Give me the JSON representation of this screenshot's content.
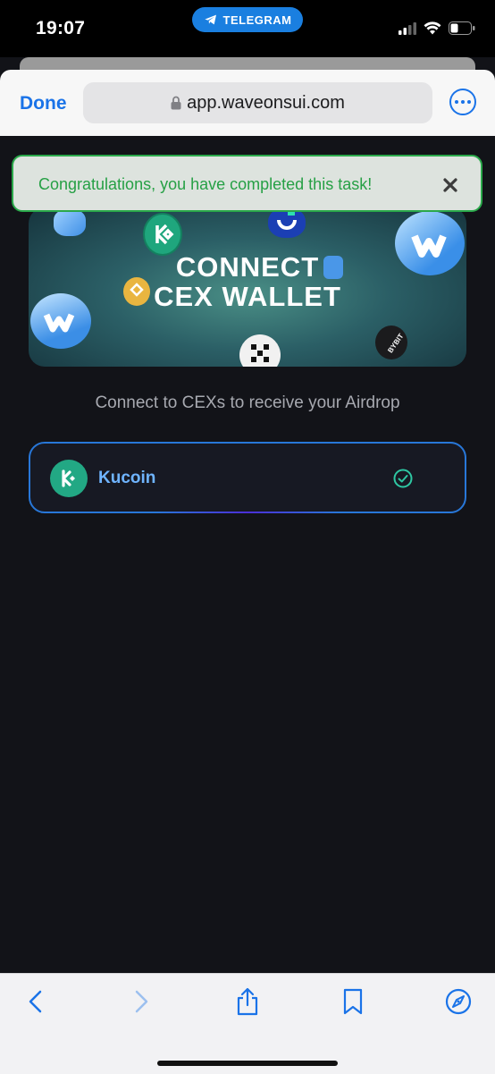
{
  "status_bar": {
    "time": "19:07",
    "back_app_label": "TELEGRAM"
  },
  "browser": {
    "done_label": "Done",
    "url": "app.waveonsui.com"
  },
  "toast": {
    "message": "Congratulations, you have completed this task!"
  },
  "banner": {
    "title_line1": "CONNECT",
    "title_line2": "CEX WALLET",
    "bybit_text": "BYBIT"
  },
  "page": {
    "subtitle": "Connect to CEXs to receive your Airdrop"
  },
  "cex_list": [
    {
      "name": "Kucoin",
      "connected": true
    }
  ],
  "colors": {
    "background": "#121318",
    "toast_border": "#2aa84a",
    "toast_text": "#26a045",
    "item_border": "#2877d8",
    "item_text": "#6fb4ff",
    "kucoin_green": "#22a884",
    "check_color": "#2ec7a3",
    "ios_blue": "#1a73e8"
  },
  "icons": {
    "toolbar": [
      "chevron-left-icon",
      "chevron-right-icon",
      "share-icon",
      "bookmarks-icon",
      "compass-icon"
    ]
  }
}
